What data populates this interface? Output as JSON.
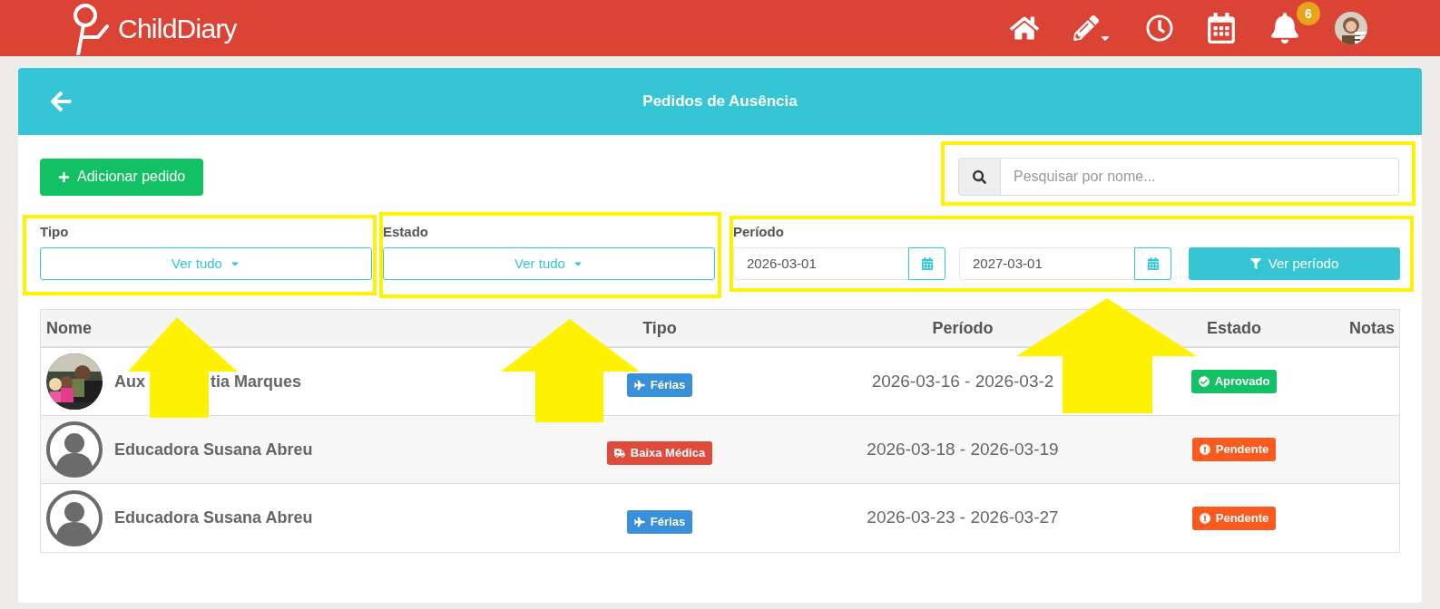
{
  "header": {
    "logo": "ChildDiary",
    "notifications": "6"
  },
  "page": {
    "title": "Pedidos de Ausência"
  },
  "add_button": "Adicionar pedido",
  "search": {
    "placeholder": "Pesquisar por nome..."
  },
  "filters": [
    {
      "label": "Tipo",
      "value": "Ver tudo"
    },
    {
      "label": "Estado",
      "value": "Ver tudo"
    }
  ],
  "period": {
    "label": "Período",
    "from": "2026-03-01",
    "to": "2027-03-01",
    "button": "Ver período"
  },
  "table": {
    "columns": [
      "Nome",
      "Tipo",
      "Período",
      "Estado",
      "Notas"
    ],
    "rows": [
      {
        "avatar": {
          "kind": "picture"
        },
        "name": [
          "Aux",
          "tia Marques"
        ],
        "type": {
          "kind": "vacation",
          "label": "Férias"
        },
        "period": "2026-03-16 - 2026-03-2",
        "status": {
          "kind": "approved",
          "label": "Aprovado"
        }
      },
      {
        "avatar": {
          "kind": "silhouette"
        },
        "name": [
          "Educadora Susana Abreu"
        ],
        "type": {
          "kind": "medical",
          "label": "Baixa Médica"
        },
        "period": "2026-03-18 - 2026-03-19",
        "status": {
          "kind": "pending",
          "label": "Pendente"
        }
      },
      {
        "avatar": {
          "kind": "silhouette"
        },
        "name": [
          "Educadora Susana Abreu"
        ],
        "type": {
          "kind": "vacation",
          "label": "Férias"
        },
        "period": "2026-03-23 - 2026-03-27",
        "status": {
          "kind": "pending",
          "label": "Pendente"
        }
      }
    ]
  }
}
